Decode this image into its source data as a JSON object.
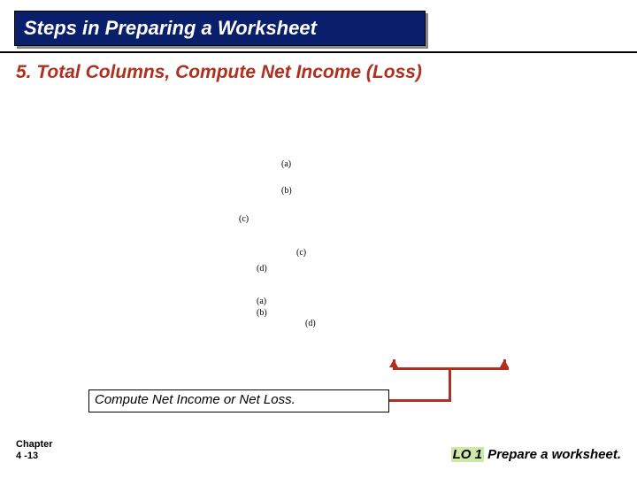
{
  "banner": {
    "title": "Steps in Preparing a Worksheet"
  },
  "subtitle": "5. Total Columns, Compute Net Income (Loss)",
  "labels": {
    "a1": "(a)",
    "b1": "(b)",
    "c1": "(c)",
    "c2": "(c)",
    "d1": "(d)",
    "a2": "(a)",
    "b2": "(b)",
    "d2": "(d)"
  },
  "callout": "Compute Net Income or Net Loss.",
  "chapter": {
    "line1": "Chapter",
    "line2": "4 -13"
  },
  "lo": {
    "prefix": "LO 1",
    "text": "  Prepare a worksheet."
  }
}
